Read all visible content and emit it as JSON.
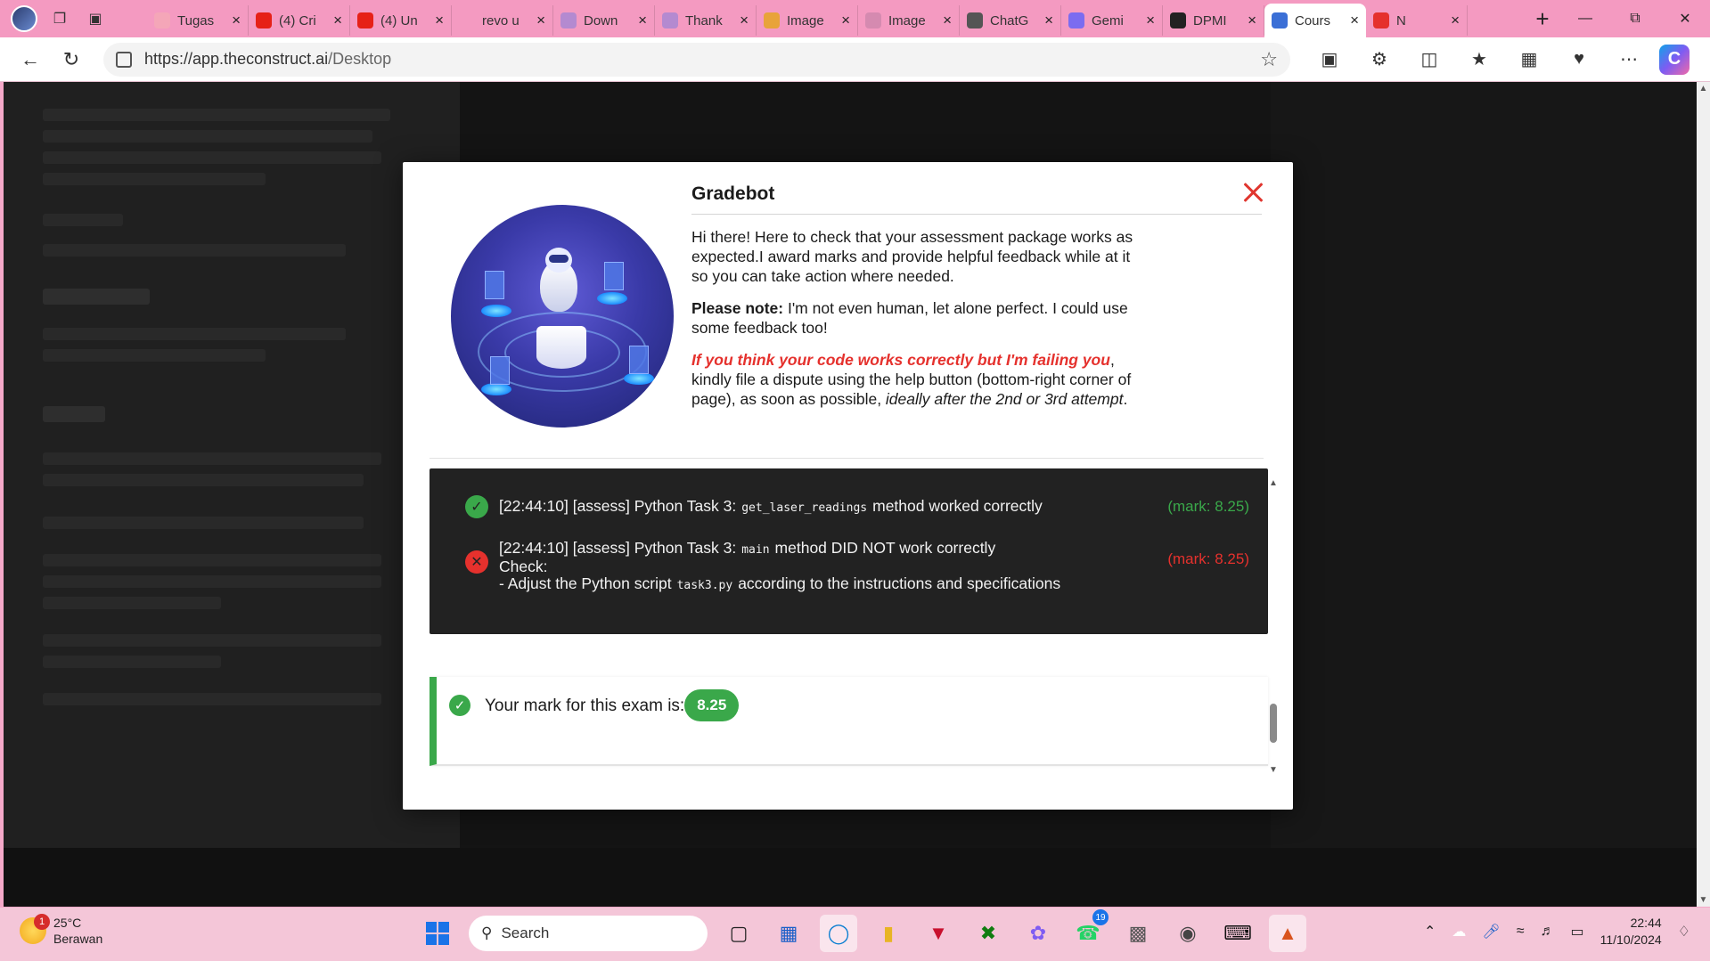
{
  "browser": {
    "tabs": [
      {
        "label": "Tugas",
        "favicon_color": "#f4a6b8"
      },
      {
        "label": "(4) Cri",
        "favicon_color": "#e62117"
      },
      {
        "label": "(4) Un",
        "favicon_color": "#e62117"
      },
      {
        "label": "revo u",
        "favicon_color": "#f49ac1"
      },
      {
        "label": "Down",
        "favicon_color": "#b48ad0"
      },
      {
        "label": "Thank",
        "favicon_color": "#b48ad0"
      },
      {
        "label": "Image",
        "favicon_color": "#e8a33a"
      },
      {
        "label": "Image",
        "favicon_color": "#d58ab0"
      },
      {
        "label": "ChatG",
        "favicon_color": "#555555"
      },
      {
        "label": "Gemi",
        "favicon_color": "#7b6cf0"
      },
      {
        "label": "DPMI",
        "favicon_color": "#222222"
      },
      {
        "label": "Cours",
        "favicon_color": "#3b6fd6",
        "active": true
      },
      {
        "label": "N",
        "favicon_color": "#e5312d"
      }
    ],
    "new_tab": "+",
    "url_host": "https://app.theconstruct.ai",
    "url_path": "/Desktop"
  },
  "modal": {
    "title": "Gradebot",
    "intro_text": "Hi there! Here to check that your assessment package works as expected.I award marks and provide helpful feedback while at it so you can take action where needed.",
    "note_label": "Please note:",
    "note_text": " I'm not even human, let alone perfect. I could use some feedback too!",
    "dispute_red": "If you think your code works correctly but I'm failing you",
    "dispute_text": ", kindly file a dispute using the help button (bottom-right corner of page), as soon as possible, ",
    "dispute_italic": "ideally after the 2nd or 3rd attempt",
    "dispute_end": ".",
    "log": [
      {
        "status": "ok",
        "prefix": "[22:44:10] [assess] Python Task 3:",
        "code": "get_laser_readings",
        "suffix": "method worked correctly",
        "mark": "(mark: 8.25)"
      },
      {
        "status": "fail",
        "prefix": "[22:44:10] [assess] Python Task 3:",
        "code": "main",
        "suffix": "method DID NOT work correctly",
        "check_label": "Check:",
        "check_prefix": "- Adjust the Python script",
        "check_code": "task3.py",
        "check_suffix": "according to the instructions and specifications",
        "mark": "(mark: 8.25)"
      }
    ],
    "result_label": "Your mark for this exam is:",
    "result_mark": "8.25"
  },
  "taskbar": {
    "weather_temp": "25°C",
    "weather_desc": "Berawan",
    "weather_badge": "1",
    "search_placeholder": "Search",
    "whatsapp_badge": "19",
    "time": "22:44",
    "date": "11/10/2024"
  },
  "colors": {
    "accent_green": "#3aa84a",
    "accent_red": "#e5312d",
    "browser_pink": "#f49ac1"
  }
}
